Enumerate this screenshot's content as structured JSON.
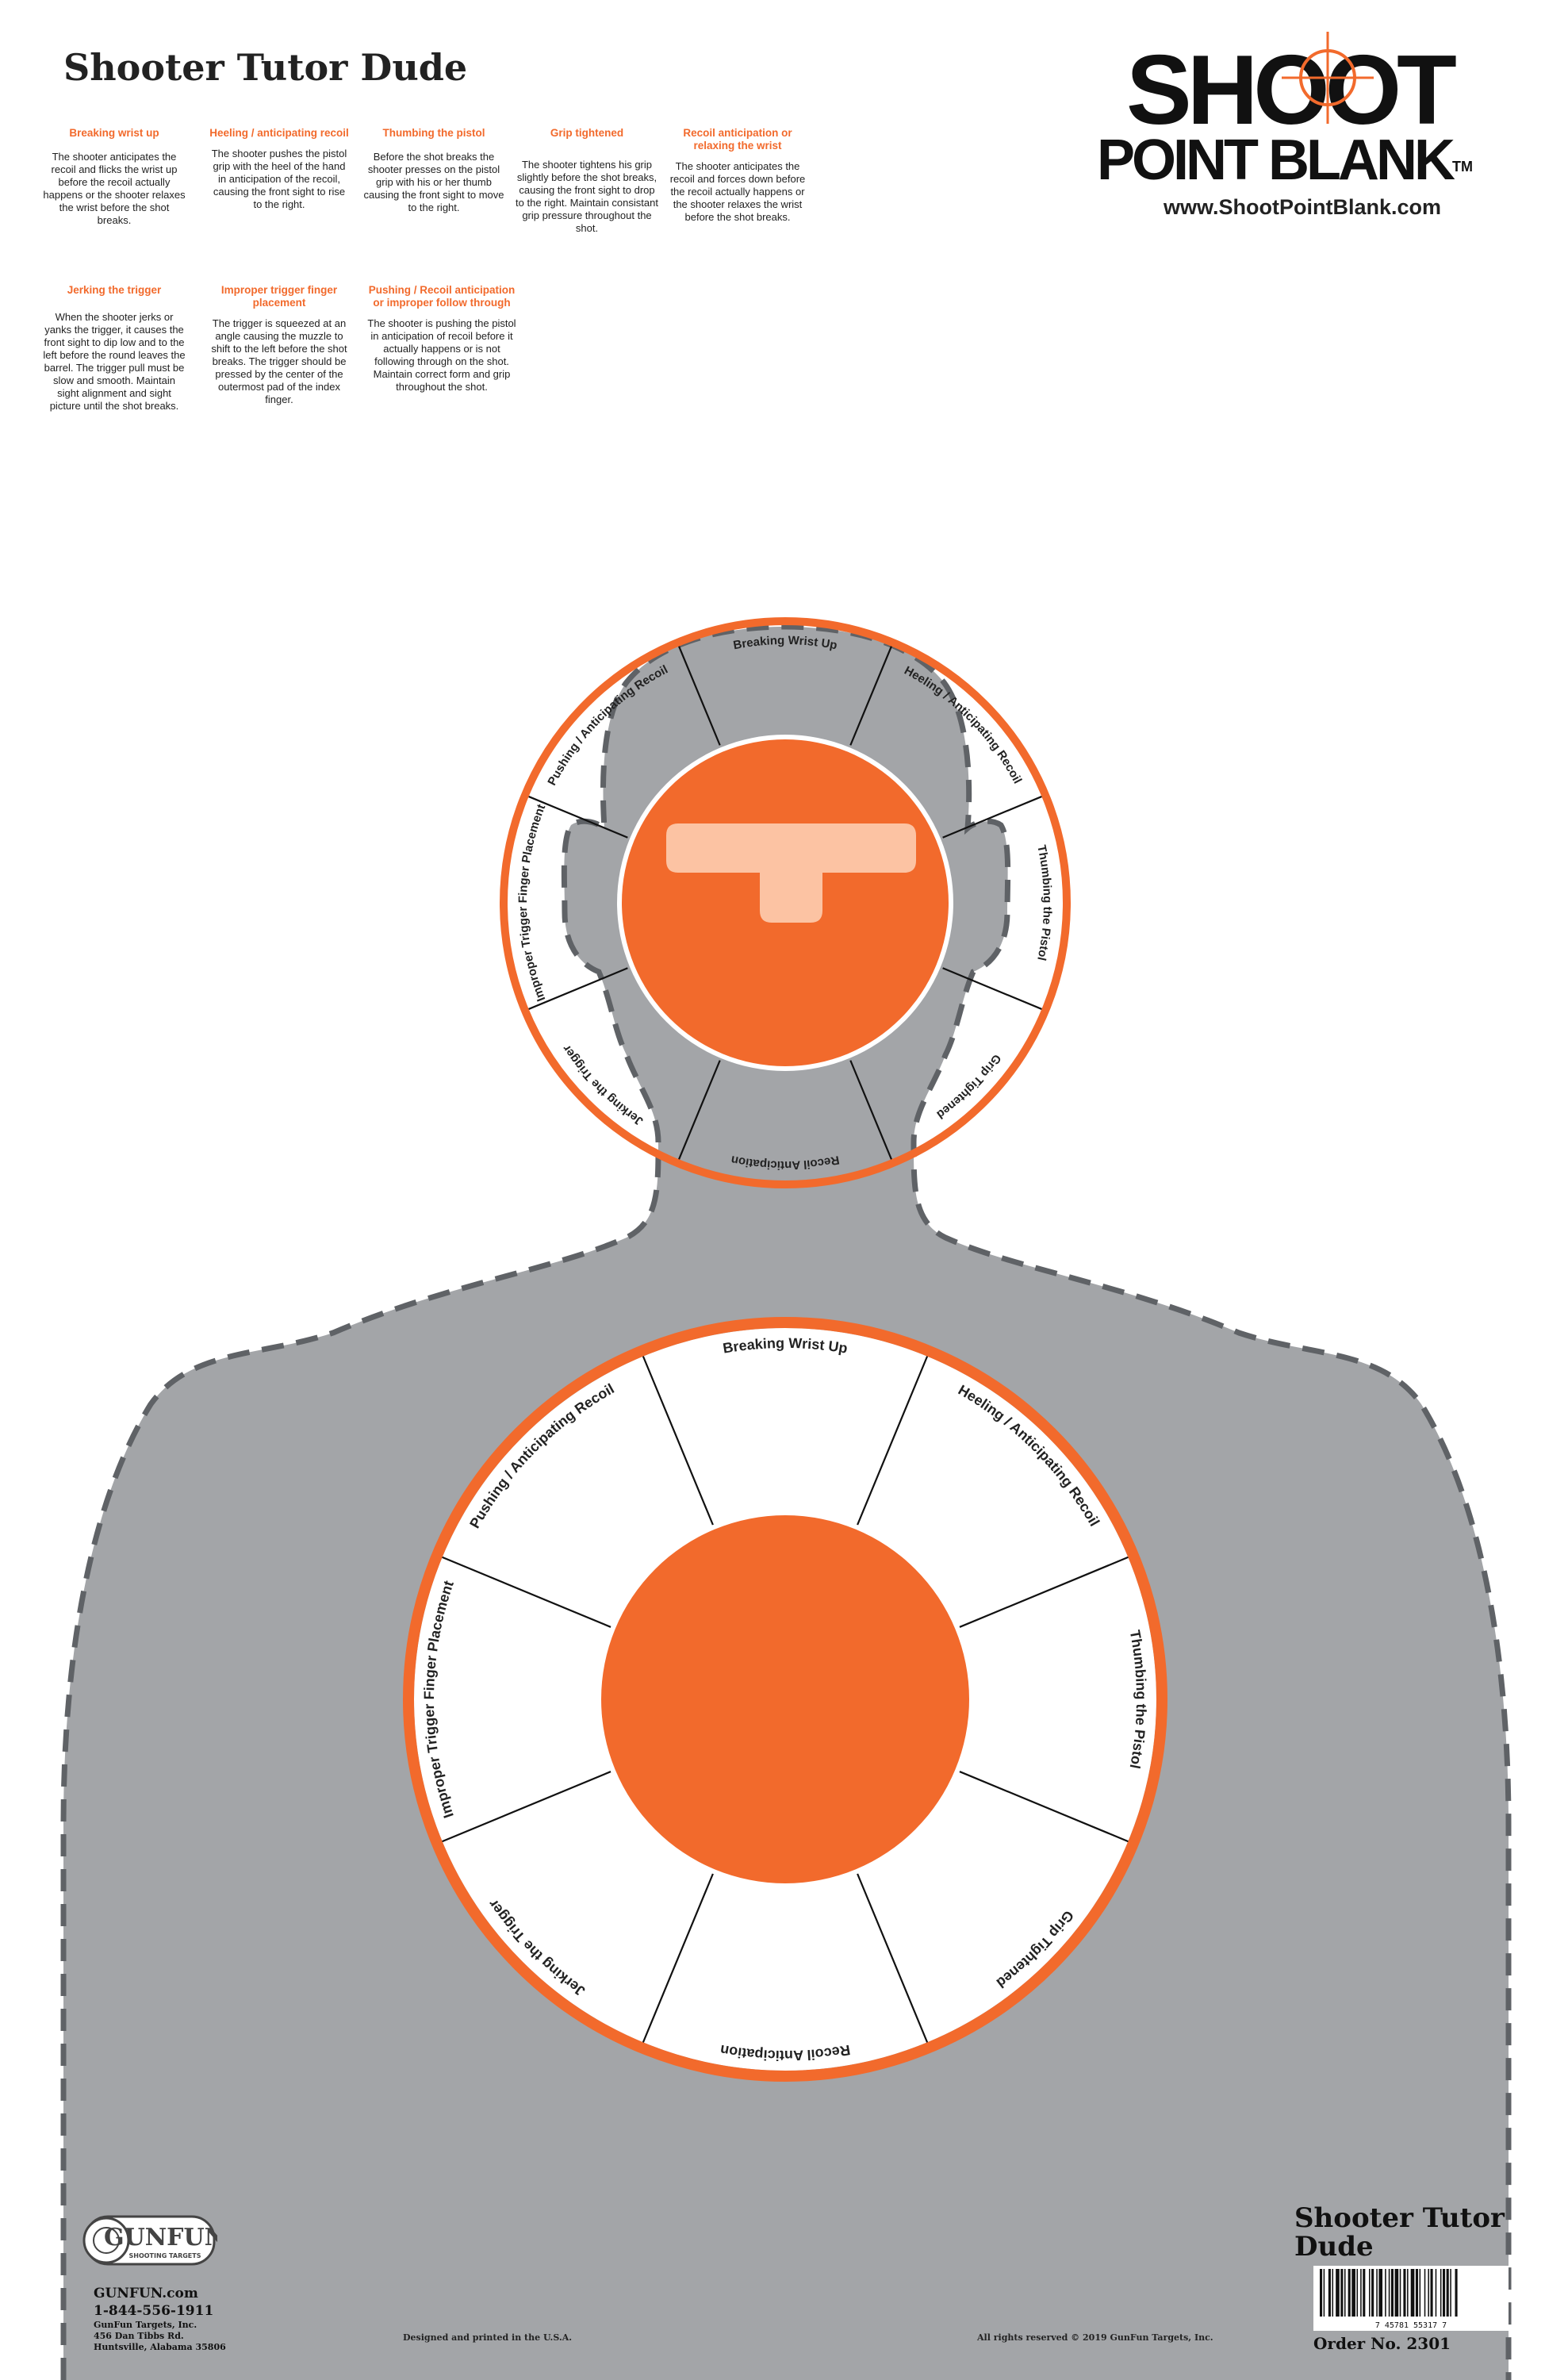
{
  "title": "Shooter Tutor Dude",
  "tips": [
    {
      "heading": "Breaking wrist up",
      "body": "The shooter anticipates the recoil and flicks the wrist up before the recoil actually happens or the shooter relaxes the wrist before the shot breaks."
    },
    {
      "heading": "Heeling / anticipating recoil",
      "body": "The shooter pushes the pistol grip with the heel of the hand in anticipation of the recoil, causing the front sight to rise to the right."
    },
    {
      "heading": "Thumbing the pistol",
      "body": "Before the shot breaks the shooter presses on the pistol grip with his or her thumb causing the front sight to move to the right."
    },
    {
      "heading": "Grip tightened",
      "body": "The shooter tightens his grip slightly before the shot breaks, causing the front sight to drop to the right. Maintain consistant grip pressure throughout the shot."
    },
    {
      "heading": "Recoil anticipation or relaxing the wrist",
      "body": "The shooter anticipates the recoil and forces down before the recoil actually happens or the shooter relaxes the wrist before the shot breaks."
    },
    {
      "heading": "Jerking the trigger",
      "body": "When the shooter jerks or yanks the trigger, it causes the front sight to dip low and to the left before the round leaves the barrel. The trigger pull must be slow and smooth. Maintain sight alignment and sight picture until the shot breaks."
    },
    {
      "heading": "Improper trigger finger placement",
      "body": "The trigger is squeezed at an angle causing the muzzle to shift to the left before the shot breaks. The trigger should be pressed by the center of the outermost pad of the index finger."
    },
    {
      "heading": "Pushing / Recoil anticipation or improper follow through",
      "body": "The shooter is pushing the pistol in anticipation of recoil before it actually happens or is not following through on the shot. Maintain correct form and grip throughout the  shot."
    }
  ],
  "brand": {
    "line1": "SHOOT",
    "line2": "POINT BLANK",
    "tm": "TM",
    "url": "www.ShootPointBlank.com"
  },
  "wheel_labels": [
    "Breaking Wrist Up",
    "Heeling / Anticipating Recoil",
    "Thumbing the Pistol",
    "Grip Tightened",
    "Recoil Anticipation",
    "Jerking the Trigger",
    "Improper Trigger Finger Placement",
    "Pushing / Anticipating Recoil"
  ],
  "colors": {
    "orange": "#f26a2c",
    "silhouette": "#a3a5a8",
    "t_zone": "#fcc3a3",
    "dash": "#5f6266"
  },
  "gunfun": {
    "logo": "GUNFUN",
    "logo_sub": "SHOOTING TARGETS",
    "url": "GUNFUN.com",
    "phone": "1-844-556-1911",
    "addr1": "GunFun Targets, Inc.",
    "addr2": "456 Dan Tibbs Rd.",
    "addr3": "Huntsville, Alabama 35806"
  },
  "footer": {
    "made": "Designed and printed in the U.S.A.",
    "rights": "All rights reserved © 2019 GunFun Targets, Inc."
  },
  "bottom": {
    "title": "Shooter Tutor Dude",
    "barcode_digits": "7  45781  55317  7",
    "order": "Order No. 2301"
  }
}
